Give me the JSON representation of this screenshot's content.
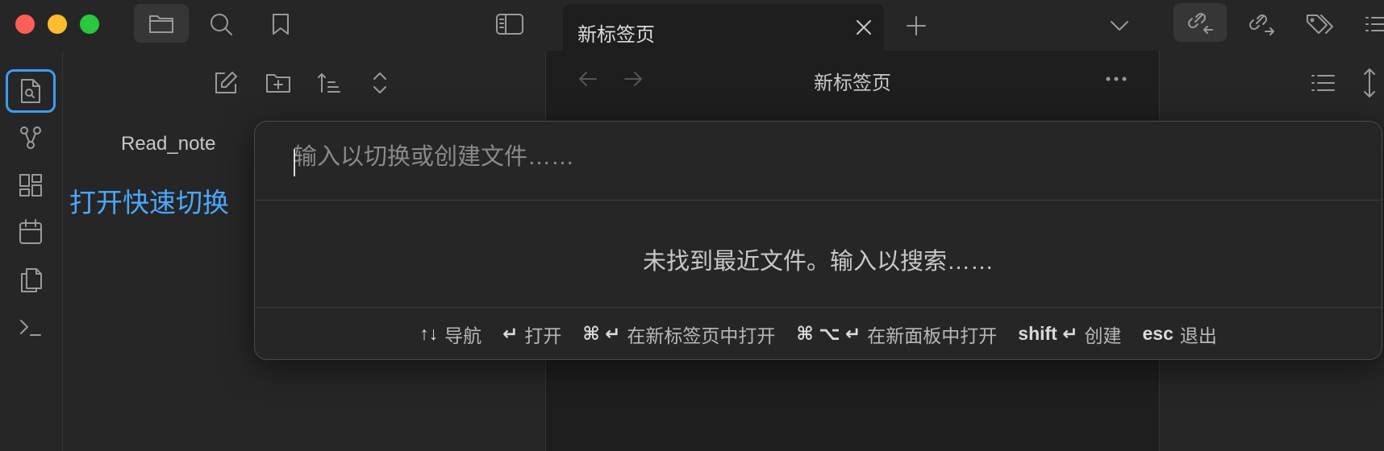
{
  "titlebar": {
    "tab_title": "新标签页"
  },
  "explorer": {
    "vault_name": "Read_note",
    "quick_open_link": "打开快速切换"
  },
  "editor": {
    "title": "新标签页"
  },
  "switcher": {
    "placeholder": "输入以切换或创建文件……",
    "empty_message": "未找到最近文件。输入以搜索……",
    "instructions": [
      {
        "key": "↑↓",
        "desc": "导航"
      },
      {
        "key": "↵",
        "desc": "打开"
      },
      {
        "key": "⌘ ↵",
        "desc": "在新标签页中打开"
      },
      {
        "key": "⌘ ⌥ ↵",
        "desc": "在新面板中打开"
      },
      {
        "key": "shift ↵",
        "desc": "创建"
      },
      {
        "key": "esc",
        "desc": "退出"
      }
    ]
  },
  "icons": {
    "close_red": "#ff5f57",
    "minimize_yellow": "#febc2e",
    "zoom_green": "#28c840",
    "accent_blue": "#4aa8ff"
  }
}
